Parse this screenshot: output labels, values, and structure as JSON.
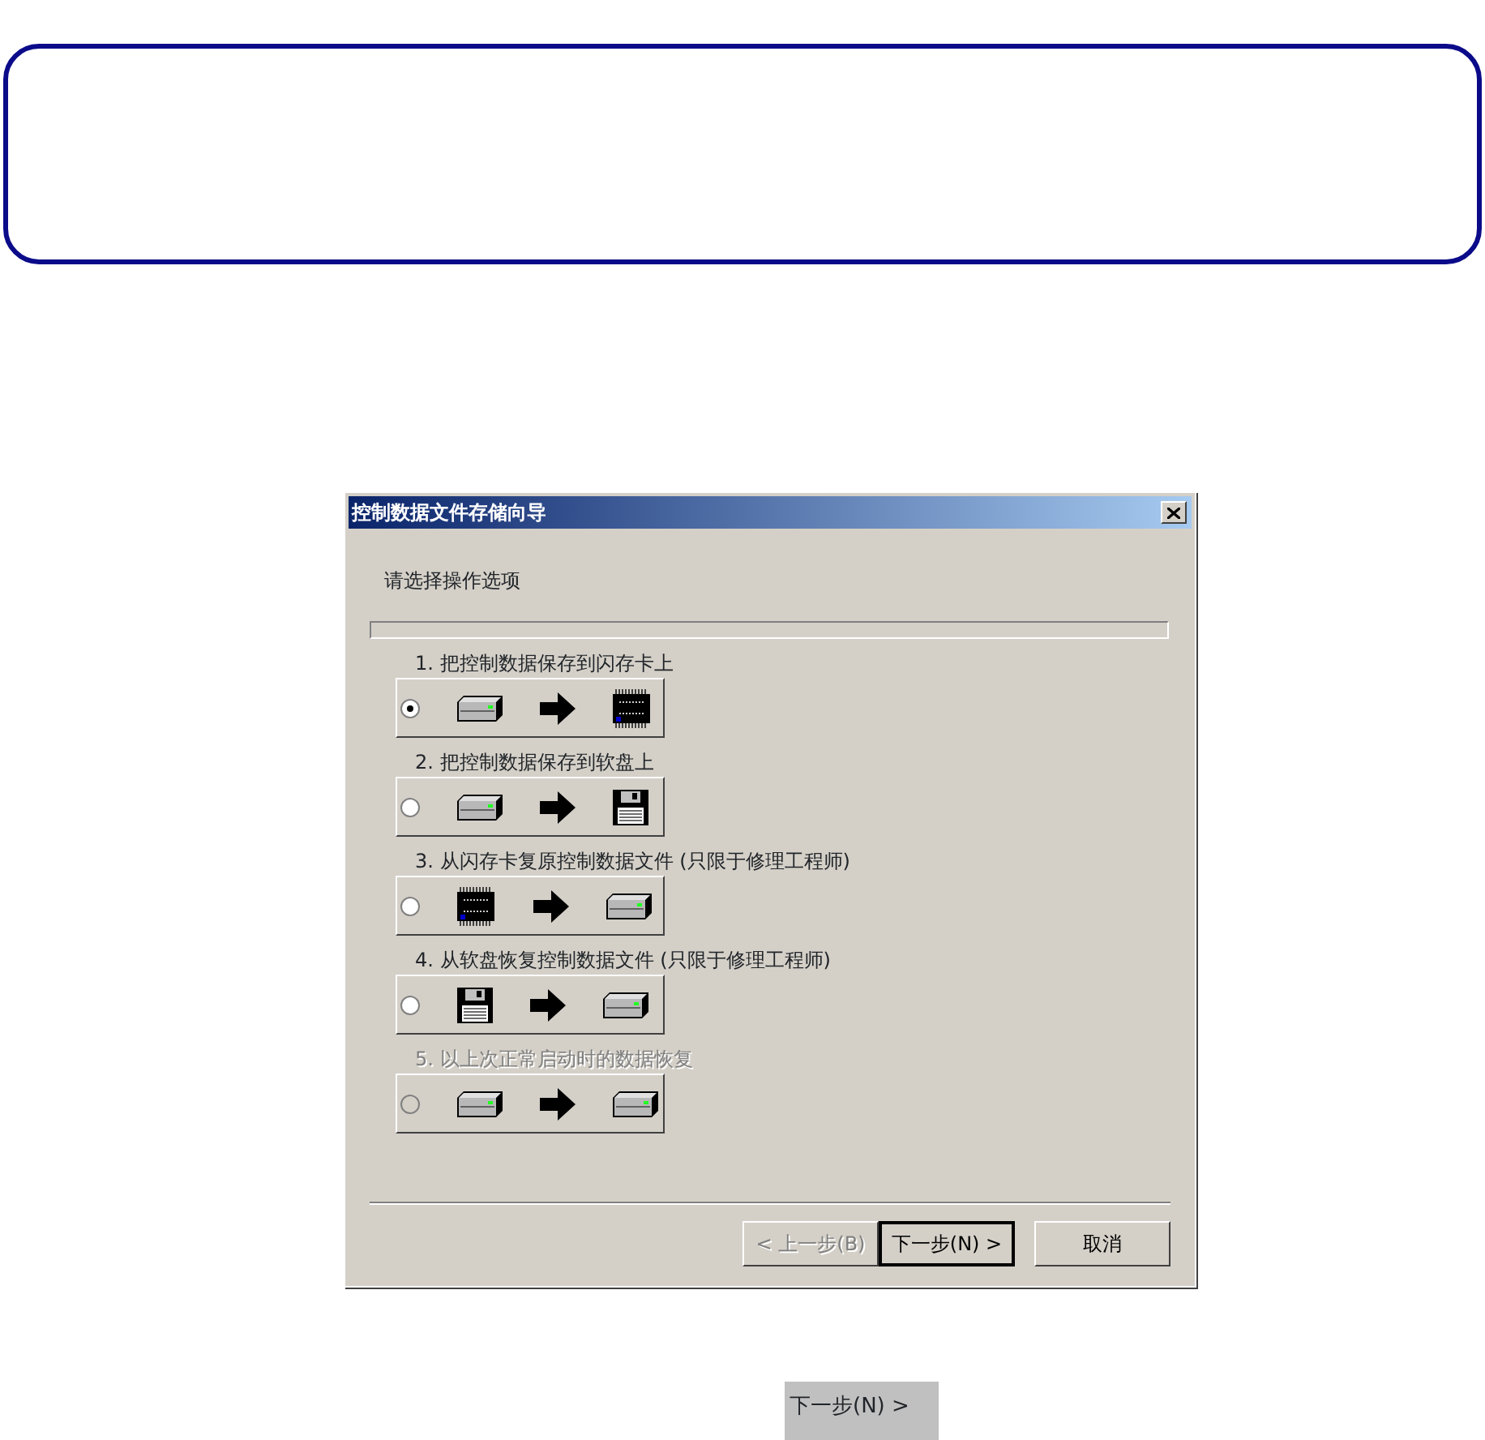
{
  "dialog": {
    "title": "控制数据文件存储向导",
    "heading": "请选择操作选项",
    "options": [
      {
        "label": "1. 把控制数据保存到闪存卡上",
        "selected": true,
        "disabled": false,
        "icons": [
          {
            "kind": "drive"
          },
          {
            "kind": "arrow"
          },
          {
            "kind": "flash"
          }
        ]
      },
      {
        "label": "2. 把控制数据保存到软盘上",
        "selected": false,
        "disabled": false,
        "icons": [
          {
            "kind": "drive"
          },
          {
            "kind": "arrow"
          },
          {
            "kind": "floppy"
          }
        ]
      },
      {
        "label": "3. 从闪存卡复原控制数据文件 (只限于修理工程师)",
        "selected": false,
        "disabled": false,
        "icons": [
          {
            "kind": "flash"
          },
          {
            "kind": "arrow"
          },
          {
            "kind": "drive"
          }
        ]
      },
      {
        "label": "4. 从软盘恢复控制数据文件 (只限于修理工程师)",
        "selected": false,
        "disabled": false,
        "icons": [
          {
            "kind": "floppy"
          },
          {
            "kind": "arrow"
          },
          {
            "kind": "drive"
          }
        ]
      },
      {
        "label": "5. 以上次正常启动时的数据恢复",
        "selected": false,
        "disabled": true,
        "icons": [
          {
            "kind": "drive"
          },
          {
            "kind": "arrow"
          },
          {
            "kind": "drive"
          }
        ]
      }
    ],
    "buttons": [
      {
        "label": "< 上一步(B)",
        "kind": "back",
        "disabled": true,
        "default": false
      },
      {
        "label": "下一步(N) >",
        "kind": "next",
        "disabled": false,
        "default": true
      },
      {
        "label": "取消",
        "kind": "cancel",
        "disabled": false,
        "default": false
      }
    ]
  },
  "caption_button": {
    "label": "下一步(N) >"
  }
}
